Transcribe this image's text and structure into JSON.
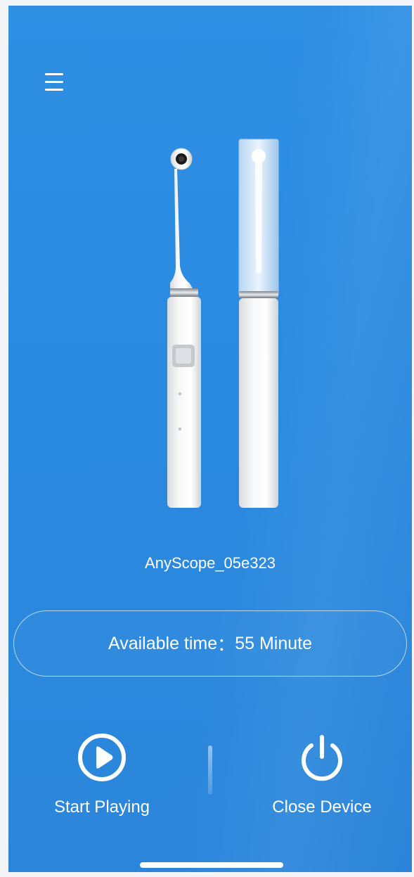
{
  "header": {
    "menu_icon": "hamburger-menu-icon"
  },
  "device": {
    "name": "AnyScope_05e323"
  },
  "status": {
    "label": "Available time",
    "separator": "：",
    "value": "55",
    "unit": "Minute"
  },
  "actions": {
    "start_label": "Start Playing",
    "start_icon": "play-circle-icon",
    "close_label": "Close Device",
    "close_icon": "power-icon"
  },
  "colors": {
    "background": "#2b8ae0",
    "text": "#ffffff"
  }
}
